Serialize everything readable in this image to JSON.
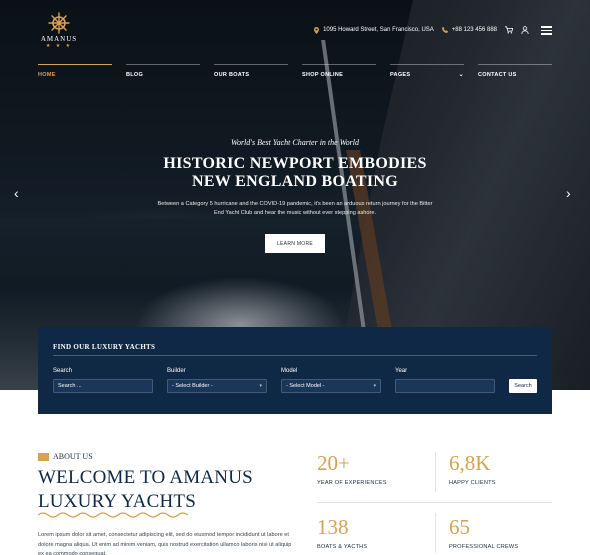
{
  "brand": {
    "name": "AMANUS",
    "accent": "#d6a253",
    "navy": "#0e2845"
  },
  "topbar": {
    "address": "1095 Howard Street, San Francisco, USA",
    "phone": "+88 123 456 888"
  },
  "nav": {
    "items": [
      {
        "label": "HOME"
      },
      {
        "label": "BLOG"
      },
      {
        "label": "OUR BOATS"
      },
      {
        "label": "SHOP ONLINE"
      },
      {
        "label": "PAGES"
      },
      {
        "label": "CONTACT US"
      }
    ]
  },
  "hero": {
    "kicker": "World's Best Yacht Charter in the World",
    "title_line1": "HISTORIC NEWPORT EMBODIES",
    "title_line2": "NEW ENGLAND BOATING",
    "description": "Between a Category 5 hurricane and the COVID-19 pandemic, it's been an arduous return journey for the Bitter End Yacht Club and hear the music without ever stepping ashore.",
    "button": "LEARN MORE",
    "arrow_left": "‹",
    "arrow_right": "›"
  },
  "search": {
    "title": "FIND OUR LUXURY YACHTS",
    "search_label": "Search",
    "search_placeholder": "Search ...",
    "builder_label": "Builder",
    "builder_value": "- Select Builder -",
    "model_label": "Model",
    "model_value": "- Select Model -",
    "year_label": "Year",
    "year_value": "",
    "button": "Search"
  },
  "about": {
    "kicker": "ABOUT US",
    "title_line1": "WELCOME TO AMANUS",
    "title_line2": "LUXURY YACHTS",
    "text": "Lorem ipsum dolor sit amet, consectetur adipiscing elit, sed do eiusmod tempor incididunt ut labore et dolore magna aliqua. Ut enim ad minim veniam, quis nostrud exercitation ullamco laboris nisi ut aliquip ex ea commodo consequat."
  },
  "stats": [
    {
      "value": "20+",
      "label": "YEAR OF EXPERIENCES"
    },
    {
      "value": "6,8K",
      "label": "HAPPY CLIENTS"
    },
    {
      "value": "138",
      "label": "BOATS & YACTHS"
    },
    {
      "value": "65",
      "label": "PROFESSIONAL CREWS"
    }
  ]
}
